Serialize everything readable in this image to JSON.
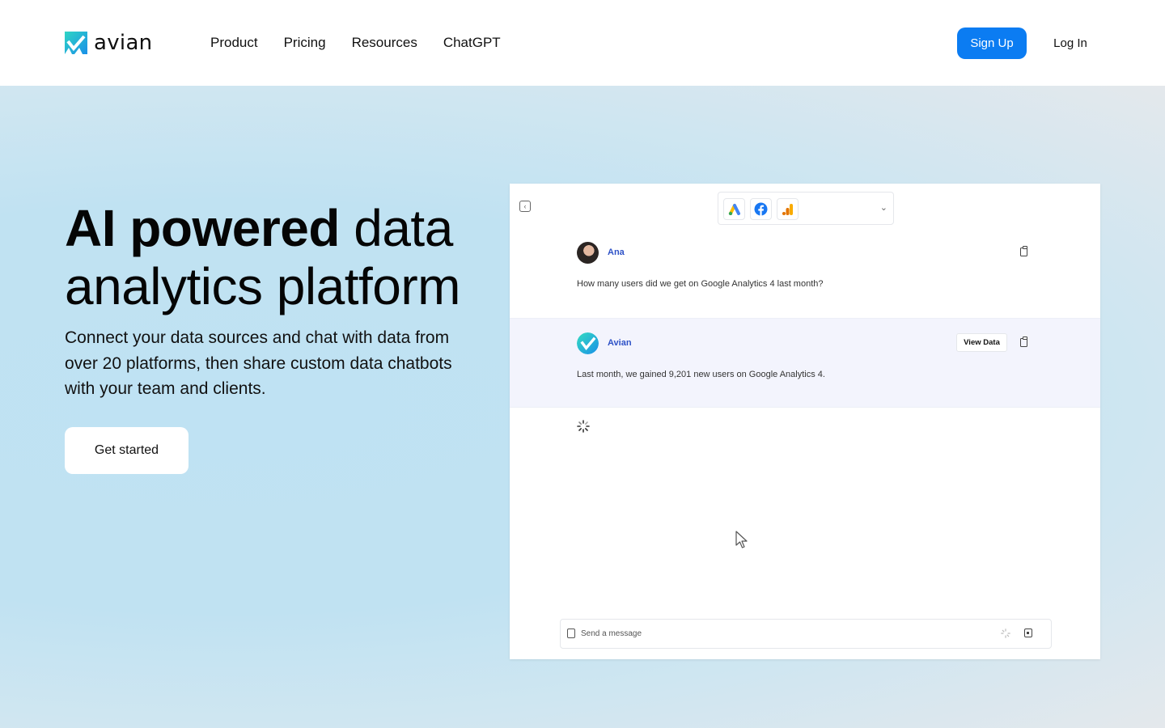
{
  "brand": {
    "name": "avian",
    "accent": "#0b7cf2"
  },
  "nav": {
    "items": [
      {
        "label": "Product"
      },
      {
        "label": "Pricing"
      },
      {
        "label": "Resources"
      },
      {
        "label": "ChatGPT"
      }
    ],
    "signup_label": "Sign Up",
    "login_label": "Log In"
  },
  "hero": {
    "headline_bold": "AI powered",
    "headline_rest": " data analytics platform",
    "subtext": "Connect your data sources and chat with data from over 20 platforms, then share custom data chatbots with your team and clients.",
    "cta_label": "Get started"
  },
  "preview": {
    "sources": [
      {
        "icon": "google-ads-icon"
      },
      {
        "icon": "facebook-icon"
      },
      {
        "icon": "google-analytics-icon"
      }
    ],
    "messages": [
      {
        "sender": "Ana",
        "text": "How many users did we get on Google Analytics 4 last month?"
      },
      {
        "sender": "Avian",
        "text": "Last month, we gained 9,201 new users on Google Analytics 4.",
        "action_label": "View Data"
      }
    ],
    "composer_placeholder": "Send a message"
  }
}
